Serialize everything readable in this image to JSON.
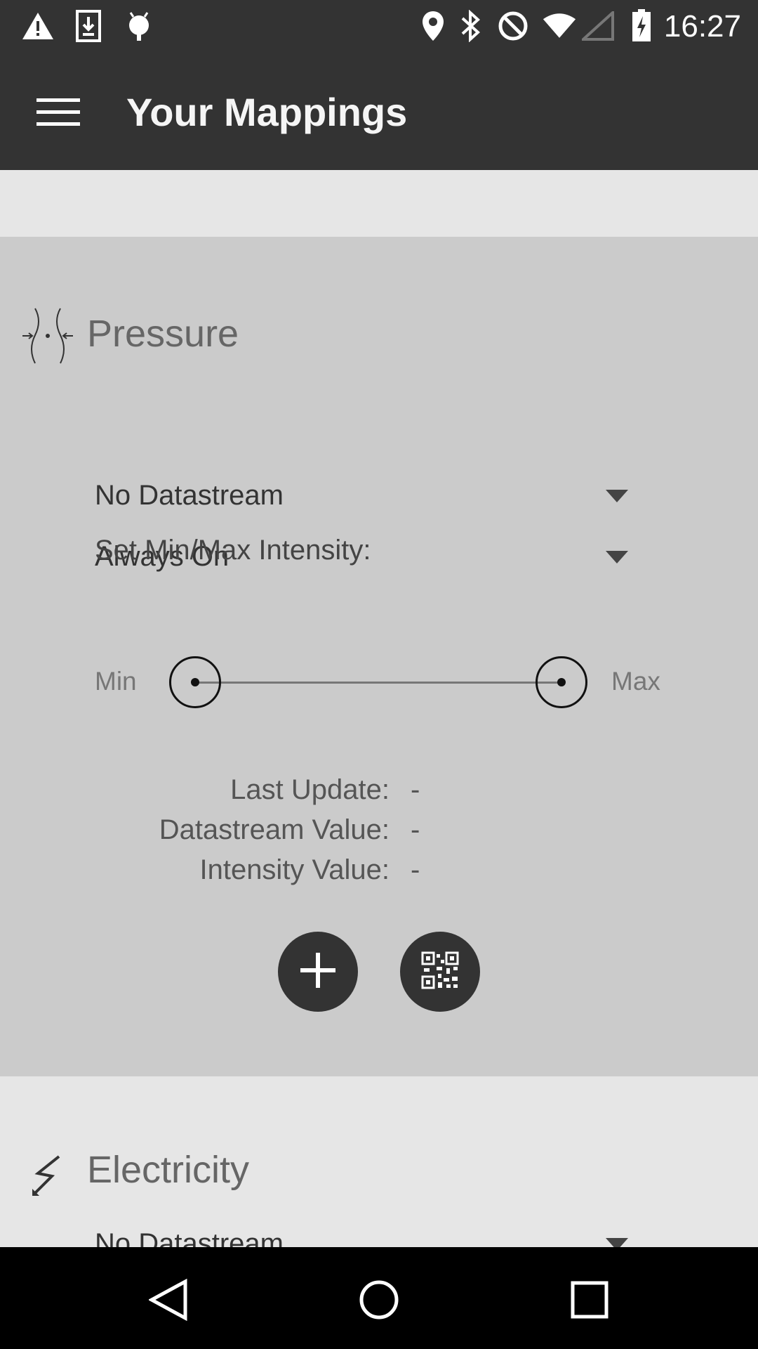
{
  "status_bar": {
    "time": "16:27",
    "left_icons": [
      "warning-icon",
      "download-icon",
      "android-debug-icon"
    ],
    "right_icons": [
      "location-icon",
      "bluetooth-icon",
      "do-not-disturb-icon",
      "wifi-icon",
      "cellular-signal-icon",
      "battery-charging-icon"
    ]
  },
  "app_bar": {
    "title": "Your Mappings",
    "menu_icon": "hamburger-menu-icon"
  },
  "pressure": {
    "title": "Pressure",
    "icon": "pressure-icon",
    "datastream_dropdown": "No Datastream",
    "mode_dropdown": "Always On",
    "intensity_heading": "Set Min/Max Intensity:",
    "slider": {
      "min_label": "Min",
      "max_label": "Max",
      "min_value": 0,
      "max_value": 1
    },
    "info": {
      "last_update_label": "Last Update:",
      "last_update_value": "-",
      "datastream_value_label": "Datastream Value:",
      "datastream_value": "-",
      "intensity_value_label": "Intensity Value:",
      "intensity_value": "-"
    },
    "actions": [
      "add-icon",
      "qr-code-icon"
    ]
  },
  "electricity": {
    "title": "Electricity",
    "icon": "electricity-icon",
    "datastream_dropdown": "No Datastream"
  },
  "navigation": [
    "back-icon",
    "home-icon",
    "recents-icon"
  ],
  "colors": {
    "bar": "#333333",
    "card_active": "#cbcbcb",
    "card_inactive": "#e6e6e6"
  }
}
